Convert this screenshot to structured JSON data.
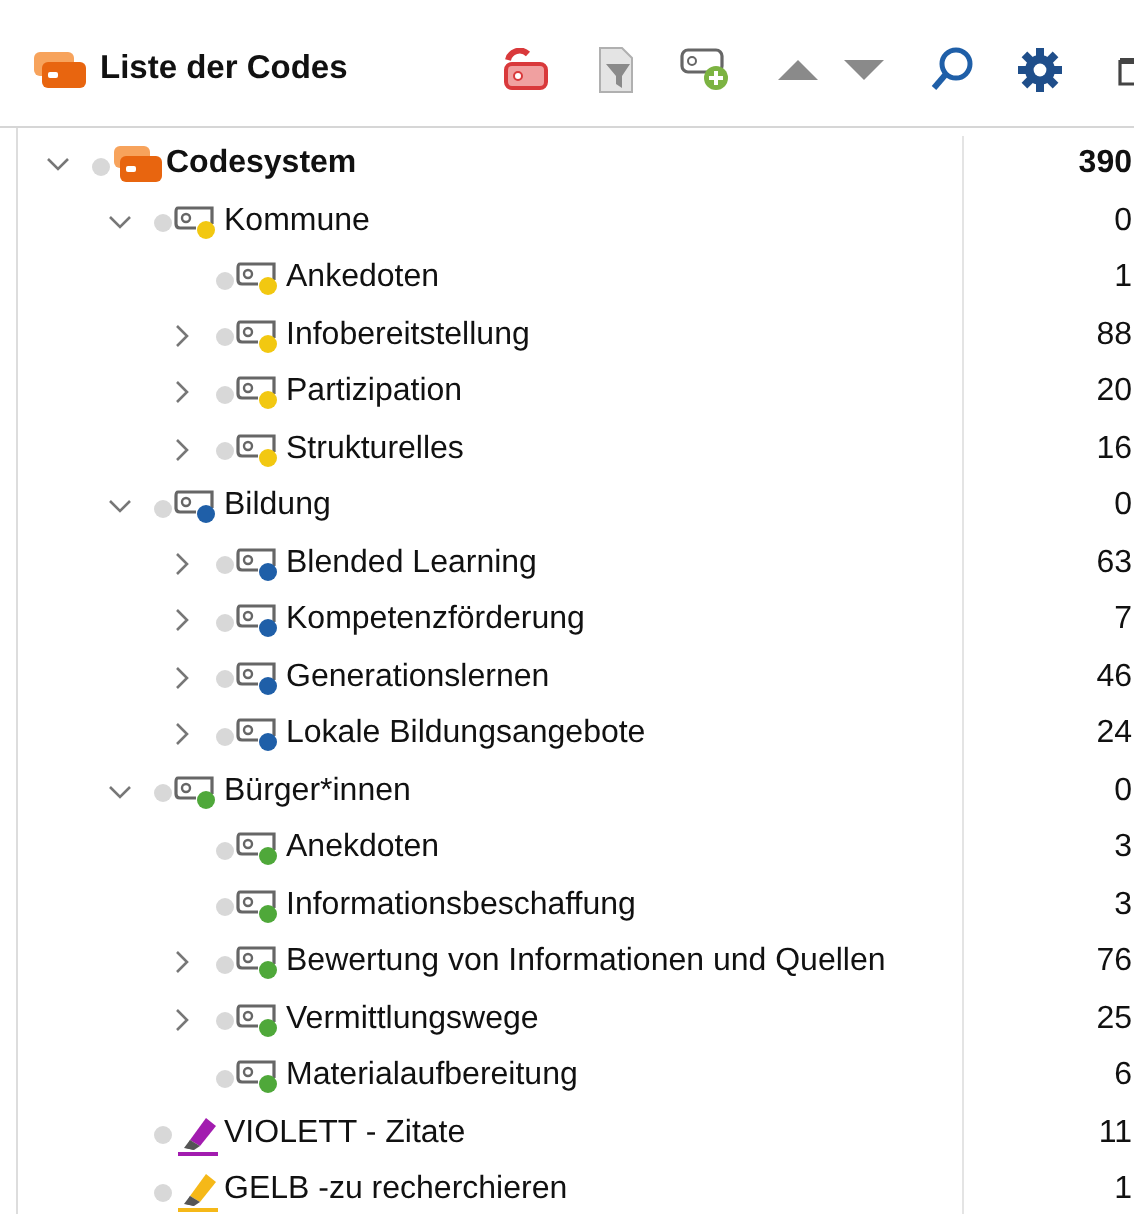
{
  "panel": {
    "title": "Liste der Codes"
  },
  "tree": [
    {
      "label": "Codesystem",
      "kind": "root",
      "count": "390",
      "expanded": true,
      "children": [
        {
          "label": "Kommune",
          "kind": "code",
          "color": "#f2c811",
          "count": "0",
          "expanded": true,
          "children": [
            {
              "label": "Ankedoten",
              "kind": "code",
              "color": "#f2c811",
              "count": "1"
            },
            {
              "label": "Infobereitstellung",
              "kind": "code",
              "color": "#f2c811",
              "count": "88",
              "expanded": false
            },
            {
              "label": "Partizipation",
              "kind": "code",
              "color": "#f2c811",
              "count": "20",
              "expanded": false
            },
            {
              "label": "Strukturelles",
              "kind": "code",
              "color": "#f2c811",
              "count": "16",
              "expanded": false
            }
          ]
        },
        {
          "label": "Bildung",
          "kind": "code",
          "color": "#1f5fa8",
          "count": "0",
          "expanded": true,
          "children": [
            {
              "label": "Blended Learning",
              "kind": "code",
              "color": "#1f5fa8",
              "count": "63",
              "expanded": false
            },
            {
              "label": "Kompetenzförderung",
              "kind": "code",
              "color": "#1f5fa8",
              "count": "7",
              "expanded": false
            },
            {
              "label": "Generationslernen",
              "kind": "code",
              "color": "#1f5fa8",
              "count": "46",
              "expanded": false
            },
            {
              "label": "Lokale Bildungsangebote",
              "kind": "code",
              "color": "#1f5fa8",
              "count": "24",
              "expanded": false
            }
          ]
        },
        {
          "label": "Bürger*innen",
          "kind": "code",
          "color": "#4fa83a",
          "count": "0",
          "expanded": true,
          "children": [
            {
              "label": "Anekdoten",
              "kind": "code",
              "color": "#4fa83a",
              "count": "3"
            },
            {
              "label": "Informationsbeschaffung",
              "kind": "code",
              "color": "#4fa83a",
              "count": "3"
            },
            {
              "label": "Bewertung von Informationen und Quellen",
              "kind": "code",
              "color": "#4fa83a",
              "count": "76",
              "expanded": false
            },
            {
              "label": "Vermittlungswege",
              "kind": "code",
              "color": "#4fa83a",
              "count": "25",
              "expanded": false
            },
            {
              "label": "Materialaufbereitung",
              "kind": "code",
              "color": "#4fa83a",
              "count": "6"
            }
          ]
        },
        {
          "label": "VIOLETT - Zitate",
          "kind": "highlighter",
          "color": "#a21caf",
          "count": "11"
        },
        {
          "label": "GELB -zu recherchieren",
          "kind": "highlighter",
          "color": "#f5b818",
          "count": "1"
        }
      ]
    }
  ]
}
